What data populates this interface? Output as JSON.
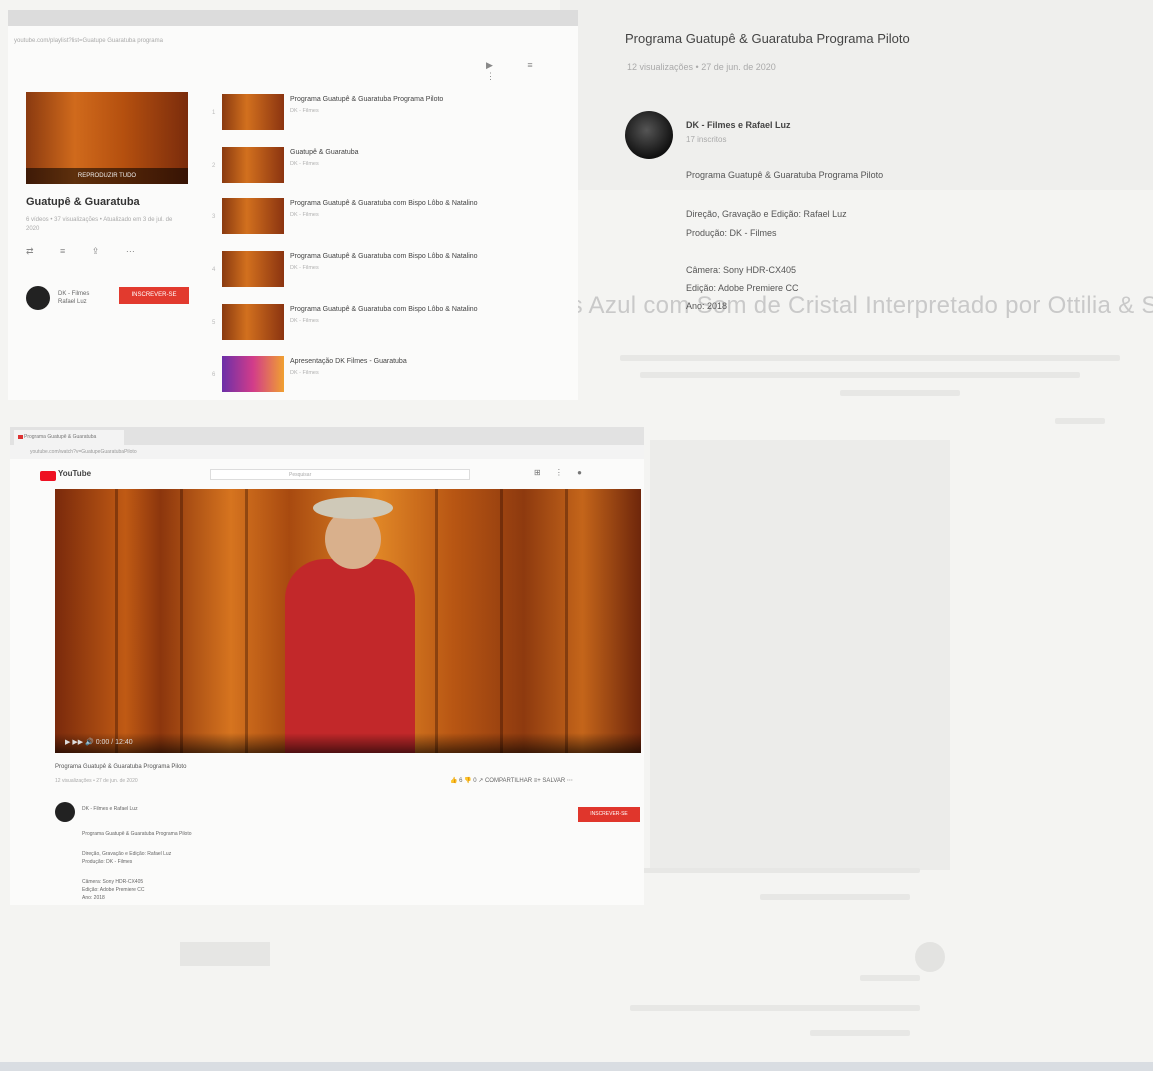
{
  "background": {
    "headline": "Boats Azul com Som de Cristal Interpretado por Ottilia & Serena Garcia"
  },
  "playlist_panel": {
    "address": "youtube.com/playlist?list=Guatupe Guaratuba programa",
    "thumb_overlay": "REPRODUZIR TUDO",
    "title": "Guatupê & Guaratuba",
    "meta": "6 vídeos • 37 visualizações • Atualizado em 3 de jul. de 2020",
    "actions": "⇄ ≡ ⇪ ⋯",
    "owner_name": "DK - Filmes",
    "owner_sub": "Rafael Luz",
    "subscribe_label": "INSCREVER-SE",
    "list_tools": "▶ ≡ ⋮",
    "items": [
      {
        "title": "Programa Guatupê & Guaratuba Programa Piloto",
        "sub": "DK - Filmes",
        "idx": "1"
      },
      {
        "title": "Guatupê & Guaratuba",
        "sub": "DK - Filmes",
        "idx": "2"
      },
      {
        "title": "Programa Guatupê & Guaratuba com Bispo Lôbo & Natalino",
        "sub": "DK - Filmes",
        "idx": "3"
      },
      {
        "title": "Programa Guatupê & Guaratuba com Bispo Lôbo & Natalino",
        "sub": "DK - Filmes",
        "idx": "4"
      },
      {
        "title": "Programa Guatupê & Guaratuba com Bispo Lôbo & Natalino",
        "sub": "DK - Filmes",
        "idx": "5"
      },
      {
        "title": "Apresentação DK Filmes - Guaratuba",
        "sub": "DK - Filmes",
        "idx": "6"
      }
    ]
  },
  "video_info": {
    "title": "Programa Guatupê & Guaratuba Programa Piloto",
    "stats": "12 visualizações • 27 de jun. de 2020",
    "channel_name": "DK - Filmes e Rafael Luz",
    "channel_subs": "17 inscritos",
    "desc_title": "Programa Guatupê & Guaratuba Programa Piloto",
    "desc_lines": [
      "Direção, Gravação e Edição: Rafael Luz",
      "Produção: DK - Filmes",
      "Câmera: Sony HDR-CX405",
      "Edição: Adobe Premiere CC",
      "Ano: 2018"
    ]
  },
  "player_panel": {
    "tab_label": "Programa Guatupê & Guaratuba",
    "url": "youtube.com/watch?v=GuatupeGuaratubaPiloto",
    "logo": "YouTube",
    "search_placeholder": "Pesquisar",
    "header_icons": "⊞ ⋮ ●",
    "controls": "▶ ▶▶ 🔊 0:00 / 12:40",
    "video_title": "Programa Guatupê & Guaratuba Programa Piloto",
    "video_stats": "12 visualizações • 27 de jun. de 2020",
    "likebar": "👍 6   👎 0   ↗ COMPARTILHAR   ≡+ SALVAR   ⋯",
    "channel": "DK - Filmes e Rafael Luz",
    "subscribe_label": "INSCREVER-SE",
    "desc_lines": [
      "Programa Guatupê & Guaratuba Programa Piloto",
      "Direção, Gravação e Edição: Rafael Luz",
      "Produção: DK - Filmes",
      "Câmera: Sony HDR-CX405",
      "Edição: Adobe Premiere CC",
      "Ano: 2018"
    ]
  }
}
